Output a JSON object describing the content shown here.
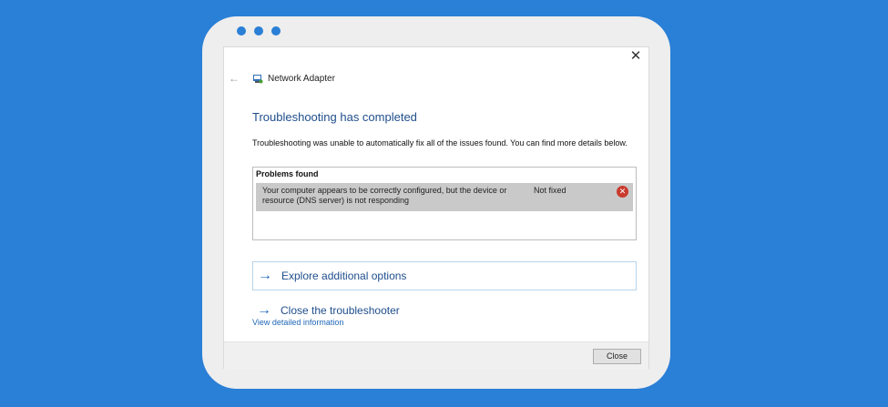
{
  "dialog": {
    "window_title": "Network Adapter",
    "heading": "Troubleshooting has completed",
    "description": "Troubleshooting was unable to automatically fix all of the issues found. You can find more details below.",
    "problems_title": "Problems found",
    "problem": {
      "text": "Your computer appears to be correctly configured, but the device or resource (DNS server) is not responding",
      "status": "Not fixed",
      "status_icon": "error-icon"
    },
    "options": [
      {
        "label": "Explore additional options",
        "icon": "arrow-right-icon"
      },
      {
        "label": "Close the troubleshooter",
        "icon": "arrow-right-icon"
      }
    ],
    "link_label": "View detailed information",
    "close_button_label": "Close",
    "close_icon": "close-icon",
    "back_icon": "back-arrow-icon",
    "adapter_icon": "network-adapter-icon"
  },
  "colors": {
    "background": "#2a7fd6",
    "frame": "#eeeeee",
    "dialog": "#ffffff",
    "heading": "#1f4e8c",
    "link": "#1f66b7",
    "error": "#c93a2d"
  }
}
